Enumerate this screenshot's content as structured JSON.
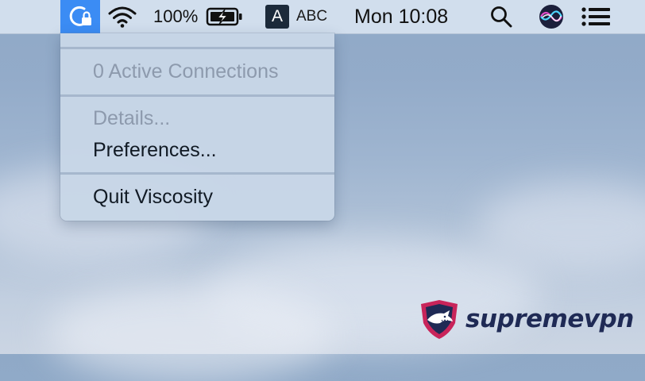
{
  "menubar": {
    "battery_percent": "100%",
    "input_source_letter": "A",
    "input_source_name": "ABC",
    "clock": "Mon 10:08"
  },
  "menu": {
    "items": [
      {
        "label": "0 Active Connections",
        "enabled": false
      },
      {
        "label": "Details...",
        "enabled": false
      },
      {
        "label": "Preferences...",
        "enabled": true
      },
      {
        "label": "Quit Viscosity",
        "enabled": true
      }
    ]
  },
  "watermark": {
    "brand": "supremevpn"
  },
  "icons": {
    "status_item": "viscosity-lock-icon",
    "wifi": "wifi-icon",
    "battery": "battery-charging-icon",
    "search": "spotlight-search-icon",
    "siri": "siri-icon",
    "notifications": "notification-center-icon",
    "brand_logo": "shark-shield-icon"
  },
  "colors": {
    "status_item_highlight": "#3b8cf4",
    "disabled_text": "#8d9aad",
    "brand_text": "#1f2a55",
    "brand_accent": "#c8245a"
  }
}
